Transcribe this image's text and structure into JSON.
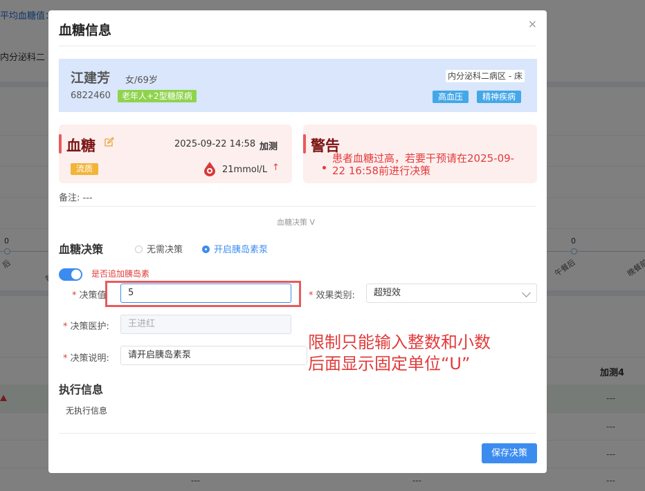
{
  "background": {
    "top_label": "平均血糖值：",
    "dept": "内分泌科二",
    "zero_labels": [
      "0",
      "0"
    ],
    "x_ticks": [
      "后",
      "前",
      "午餐后",
      "晚餐前"
    ],
    "column_header": "加测4",
    "cells": [
      "---",
      "---",
      "---",
      "---",
      "---",
      "---"
    ]
  },
  "modal": {
    "title": "血糖信息",
    "close_icon": "×"
  },
  "patient": {
    "name": "江建芳",
    "gender_age": "女/69岁",
    "id": "6822460",
    "tag": "老年人+2型糖尿病",
    "ward": "内分泌科二病区 - 床",
    "tags": [
      "高血压",
      "精神疾病"
    ]
  },
  "glucose": {
    "title": "血糖",
    "datetime": "2025-09-22 14:58",
    "type": "加测",
    "diet_tag": "流质",
    "value": "21mmol/L",
    "trend": "↑"
  },
  "warning": {
    "title": "警告",
    "message": "患者血糖过高，若要干预请在2025-09-22 16:58前进行决策"
  },
  "remark": "备注: ---",
  "collapse_label": "血糖决策 ᐯ",
  "decision": {
    "section_title": "血糖决策",
    "options": [
      "无需决策",
      "开启胰岛素泵"
    ],
    "selected_option": "开启胰岛素泵",
    "switch_label": "是否追加胰岛素",
    "switch_on": true,
    "fields": {
      "value_label": "决策值",
      "value": "5",
      "effect_label": "效果类别:",
      "effect_value": "超短效",
      "doctor_label": "决策医护:",
      "doctor_placeholder": "王进红",
      "desc_label": "决策说明:",
      "desc_value": "请开启胰岛素泵"
    }
  },
  "annotation": {
    "line1": "限制只能输入整数和小数",
    "line2": "后面显示固定单位“U”"
  },
  "execution": {
    "section_title": "执行信息",
    "empty_text": "无执行信息"
  },
  "save_label": "保存决策",
  "colors": {
    "primary": "#3c8cf0",
    "danger": "#e23b3b",
    "patient_bg": "#d9e6fb",
    "card_bg": "#fdefee"
  }
}
